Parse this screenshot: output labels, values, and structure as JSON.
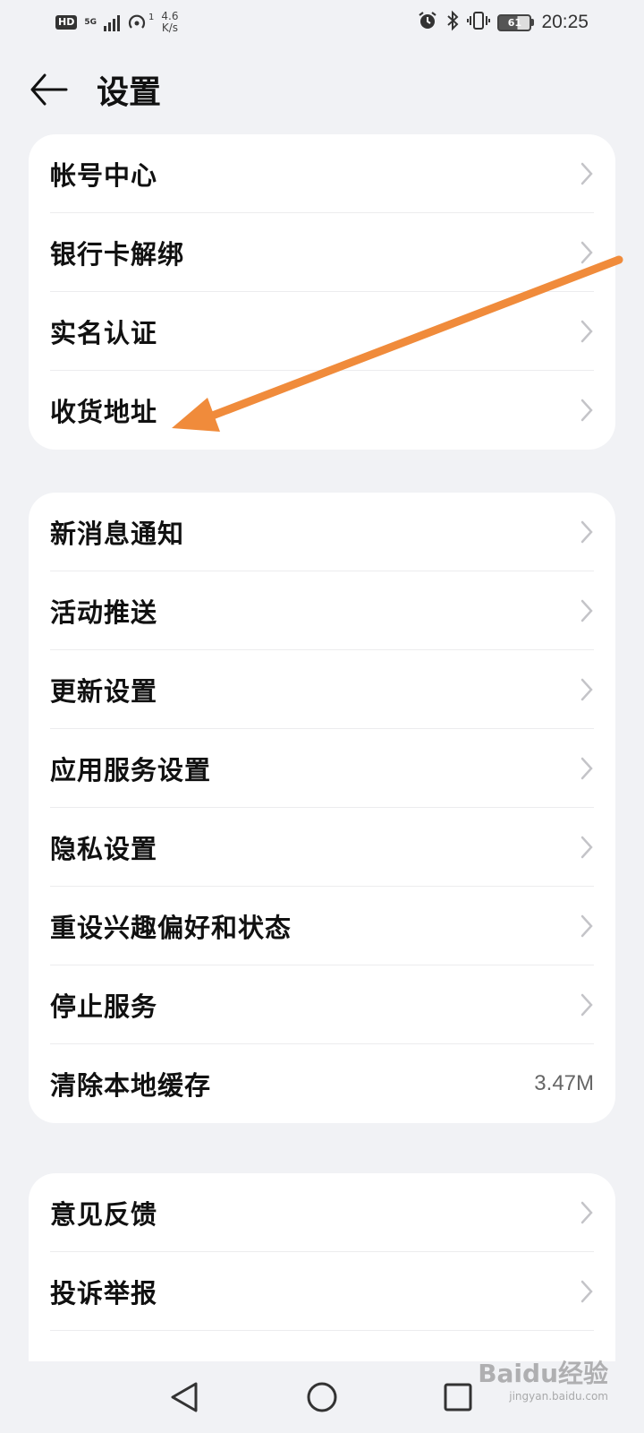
{
  "status_bar": {
    "hd": "HD",
    "network": "5G",
    "hotspot_count": "1",
    "speed_value": "4.6",
    "speed_unit": "K/s",
    "battery": "61",
    "time": "20:25",
    "icons": [
      "signal-icon",
      "hotspot-icon",
      "alarm-icon",
      "bluetooth-icon",
      "vibrate-icon",
      "battery-icon"
    ]
  },
  "header": {
    "title": "设置"
  },
  "groups": [
    {
      "items": [
        {
          "label": "帐号中心"
        },
        {
          "label": "银行卡解绑"
        },
        {
          "label": "实名认证"
        },
        {
          "label": "收货地址"
        }
      ]
    },
    {
      "items": [
        {
          "label": "新消息通知"
        },
        {
          "label": "活动推送"
        },
        {
          "label": "更新设置"
        },
        {
          "label": "应用服务设置"
        },
        {
          "label": "隐私设置"
        },
        {
          "label": "重设兴趣偏好和状态"
        },
        {
          "label": "停止服务"
        },
        {
          "label": "清除本地缓存",
          "value": "3.47M"
        }
      ]
    },
    {
      "items": [
        {
          "label": "意见反馈"
        },
        {
          "label": "投诉举报"
        }
      ]
    }
  ],
  "annotation": {
    "color": "#f08b3b",
    "points_to": "收货地址"
  },
  "watermark": {
    "main": "Baidu经验",
    "sub": "jingyan.baidu.com"
  },
  "colors": {
    "background": "#f1f2f5",
    "card": "#ffffff",
    "chevron": "#c4c4c8",
    "arrow": "#f08b3b"
  }
}
